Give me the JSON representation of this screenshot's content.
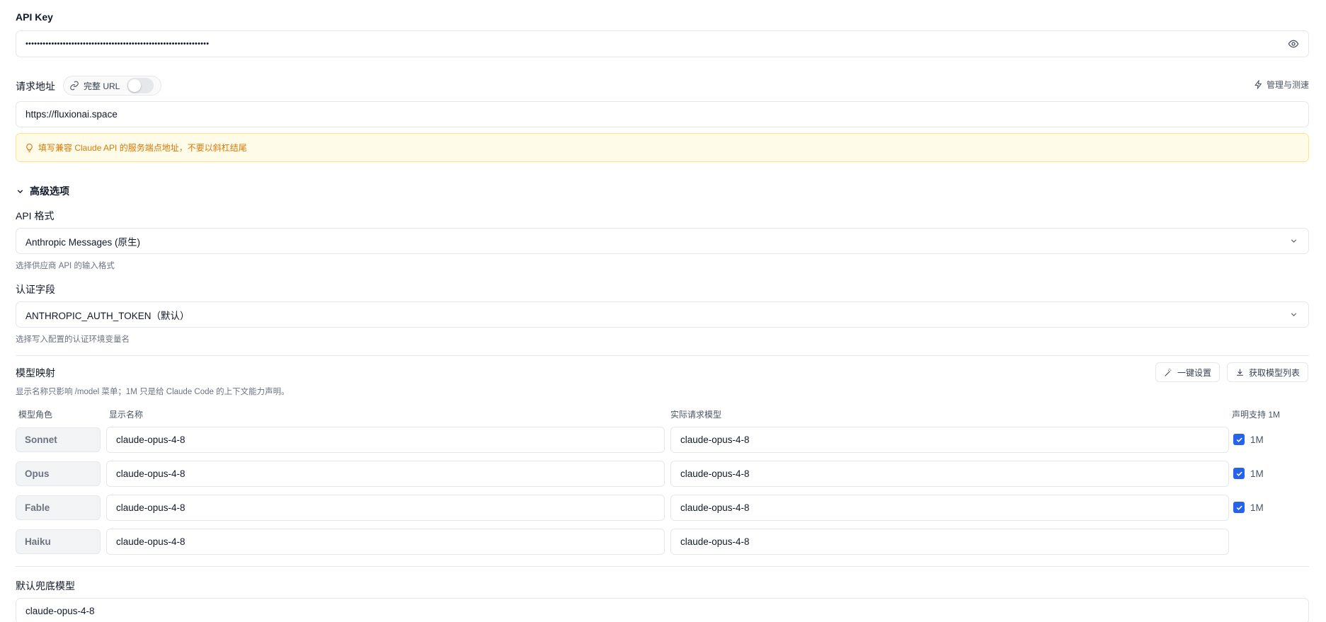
{
  "api_key": {
    "label": "API Key",
    "masked_value": "••••••••••••••••••••••••••••••••••••••••••••••••••••••••••••••••"
  },
  "endpoint": {
    "label": "请求地址",
    "full_url_toggle_label": "完整 URL",
    "manage_link": "管理与测速",
    "value": "https://fluxionai.space",
    "tip": "填写兼容 Claude API 的服务端点地址，不要以斜杠结尾"
  },
  "advanced": {
    "title": "高级选项",
    "api_format_label": "API 格式",
    "api_format_value": "Anthropic Messages (原生)",
    "api_format_hint": "选择供应商 API 的输入格式",
    "auth_label": "认证字段",
    "auth_value": "ANTHROPIC_AUTH_TOKEN（默认）",
    "auth_hint": "选择写入配置的认证环境变量名"
  },
  "model_mapping": {
    "title": "模型映射",
    "hint": "显示名称只影响 /model 菜单；1M 只是给 Claude Code 的上下文能力声明。",
    "one_click_label": "一键设置",
    "fetch_list_label": "获取模型列表",
    "columns": {
      "role": "模型角色",
      "display_name": "显示名称",
      "actual_model": "实际请求模型",
      "declare_1m": "声明支持 1M"
    },
    "rows": [
      {
        "role": "Sonnet",
        "display": "claude-opus-4-8",
        "actual": "claude-opus-4-8",
        "has_1m": true,
        "label_1m": "1M"
      },
      {
        "role": "Opus",
        "display": "claude-opus-4-8",
        "actual": "claude-opus-4-8",
        "has_1m": true,
        "label_1m": "1M"
      },
      {
        "role": "Fable",
        "display": "claude-opus-4-8",
        "actual": "claude-opus-4-8",
        "has_1m": true,
        "label_1m": "1M"
      },
      {
        "role": "Haiku",
        "display": "claude-opus-4-8",
        "actual": "claude-opus-4-8",
        "has_1m": false,
        "label_1m": ""
      }
    ]
  },
  "fallback": {
    "label": "默认兜底模型",
    "value": "claude-opus-4-8"
  },
  "colors": {
    "accent": "#2563eb",
    "warning_text": "#d97706",
    "warning_bg": "#fefce8"
  }
}
